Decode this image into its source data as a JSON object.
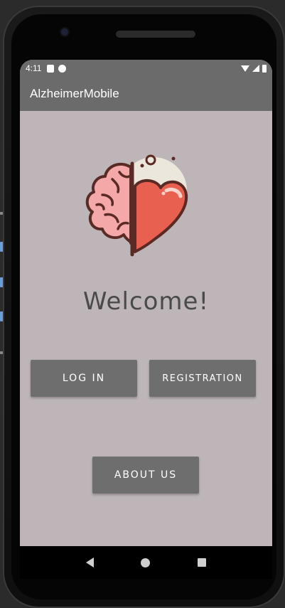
{
  "status_bar": {
    "time": "4:11",
    "icons": [
      "sd-card-icon",
      "sync-icon",
      "wifi-icon",
      "signal-icon",
      "battery-icon"
    ]
  },
  "app_bar": {
    "title": "AlzheimerMobile"
  },
  "logo": {
    "icons": [
      "brain-icon",
      "heart-icon"
    ]
  },
  "main": {
    "welcome_text": "Welcome!",
    "login_label": "LOG IN",
    "registration_label": "REGISTRATION",
    "about_label": "ABOUT US"
  },
  "nav_bar": {
    "icons": [
      "back-icon",
      "home-icon",
      "recents-icon"
    ]
  },
  "colors": {
    "screen_bg": "#bdb5b7",
    "app_bar": "#6b6b6b",
    "button": "#6e6e6e",
    "brain": "#f4a9a8",
    "heart": "#e8604f",
    "outline": "#5a2a25",
    "circle_bg": "#ece7dc"
  }
}
